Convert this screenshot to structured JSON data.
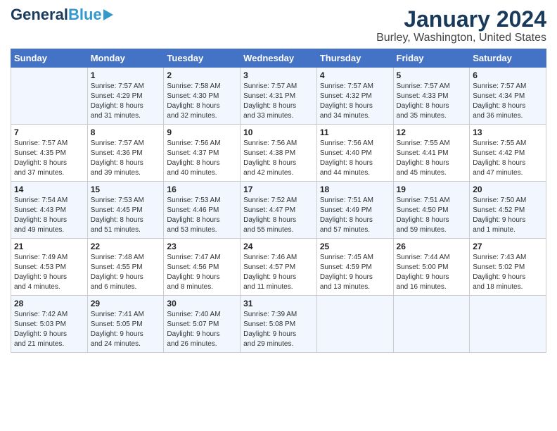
{
  "header": {
    "logo_general": "General",
    "logo_blue": "Blue",
    "title": "January 2024",
    "subtitle": "Burley, Washington, United States"
  },
  "days_of_week": [
    "Sunday",
    "Monday",
    "Tuesday",
    "Wednesday",
    "Thursday",
    "Friday",
    "Saturday"
  ],
  "weeks": [
    [
      {
        "day": "",
        "content": ""
      },
      {
        "day": "1",
        "content": "Sunrise: 7:57 AM\nSunset: 4:29 PM\nDaylight: 8 hours\nand 31 minutes."
      },
      {
        "day": "2",
        "content": "Sunrise: 7:58 AM\nSunset: 4:30 PM\nDaylight: 8 hours\nand 32 minutes."
      },
      {
        "day": "3",
        "content": "Sunrise: 7:57 AM\nSunset: 4:31 PM\nDaylight: 8 hours\nand 33 minutes."
      },
      {
        "day": "4",
        "content": "Sunrise: 7:57 AM\nSunset: 4:32 PM\nDaylight: 8 hours\nand 34 minutes."
      },
      {
        "day": "5",
        "content": "Sunrise: 7:57 AM\nSunset: 4:33 PM\nDaylight: 8 hours\nand 35 minutes."
      },
      {
        "day": "6",
        "content": "Sunrise: 7:57 AM\nSunset: 4:34 PM\nDaylight: 8 hours\nand 36 minutes."
      }
    ],
    [
      {
        "day": "7",
        "content": "Sunrise: 7:57 AM\nSunset: 4:35 PM\nDaylight: 8 hours\nand 37 minutes."
      },
      {
        "day": "8",
        "content": "Sunrise: 7:57 AM\nSunset: 4:36 PM\nDaylight: 8 hours\nand 39 minutes."
      },
      {
        "day": "9",
        "content": "Sunrise: 7:56 AM\nSunset: 4:37 PM\nDaylight: 8 hours\nand 40 minutes."
      },
      {
        "day": "10",
        "content": "Sunrise: 7:56 AM\nSunset: 4:38 PM\nDaylight: 8 hours\nand 42 minutes."
      },
      {
        "day": "11",
        "content": "Sunrise: 7:56 AM\nSunset: 4:40 PM\nDaylight: 8 hours\nand 44 minutes."
      },
      {
        "day": "12",
        "content": "Sunrise: 7:55 AM\nSunset: 4:41 PM\nDaylight: 8 hours\nand 45 minutes."
      },
      {
        "day": "13",
        "content": "Sunrise: 7:55 AM\nSunset: 4:42 PM\nDaylight: 8 hours\nand 47 minutes."
      }
    ],
    [
      {
        "day": "14",
        "content": "Sunrise: 7:54 AM\nSunset: 4:43 PM\nDaylight: 8 hours\nand 49 minutes."
      },
      {
        "day": "15",
        "content": "Sunrise: 7:53 AM\nSunset: 4:45 PM\nDaylight: 8 hours\nand 51 minutes."
      },
      {
        "day": "16",
        "content": "Sunrise: 7:53 AM\nSunset: 4:46 PM\nDaylight: 8 hours\nand 53 minutes."
      },
      {
        "day": "17",
        "content": "Sunrise: 7:52 AM\nSunset: 4:47 PM\nDaylight: 8 hours\nand 55 minutes."
      },
      {
        "day": "18",
        "content": "Sunrise: 7:51 AM\nSunset: 4:49 PM\nDaylight: 8 hours\nand 57 minutes."
      },
      {
        "day": "19",
        "content": "Sunrise: 7:51 AM\nSunset: 4:50 PM\nDaylight: 8 hours\nand 59 minutes."
      },
      {
        "day": "20",
        "content": "Sunrise: 7:50 AM\nSunset: 4:52 PM\nDaylight: 9 hours\nand 1 minute."
      }
    ],
    [
      {
        "day": "21",
        "content": "Sunrise: 7:49 AM\nSunset: 4:53 PM\nDaylight: 9 hours\nand 4 minutes."
      },
      {
        "day": "22",
        "content": "Sunrise: 7:48 AM\nSunset: 4:55 PM\nDaylight: 9 hours\nand 6 minutes."
      },
      {
        "day": "23",
        "content": "Sunrise: 7:47 AM\nSunset: 4:56 PM\nDaylight: 9 hours\nand 8 minutes."
      },
      {
        "day": "24",
        "content": "Sunrise: 7:46 AM\nSunset: 4:57 PM\nDaylight: 9 hours\nand 11 minutes."
      },
      {
        "day": "25",
        "content": "Sunrise: 7:45 AM\nSunset: 4:59 PM\nDaylight: 9 hours\nand 13 minutes."
      },
      {
        "day": "26",
        "content": "Sunrise: 7:44 AM\nSunset: 5:00 PM\nDaylight: 9 hours\nand 16 minutes."
      },
      {
        "day": "27",
        "content": "Sunrise: 7:43 AM\nSunset: 5:02 PM\nDaylight: 9 hours\nand 18 minutes."
      }
    ],
    [
      {
        "day": "28",
        "content": "Sunrise: 7:42 AM\nSunset: 5:03 PM\nDaylight: 9 hours\nand 21 minutes."
      },
      {
        "day": "29",
        "content": "Sunrise: 7:41 AM\nSunset: 5:05 PM\nDaylight: 9 hours\nand 24 minutes."
      },
      {
        "day": "30",
        "content": "Sunrise: 7:40 AM\nSunset: 5:07 PM\nDaylight: 9 hours\nand 26 minutes."
      },
      {
        "day": "31",
        "content": "Sunrise: 7:39 AM\nSunset: 5:08 PM\nDaylight: 9 hours\nand 29 minutes."
      },
      {
        "day": "",
        "content": ""
      },
      {
        "day": "",
        "content": ""
      },
      {
        "day": "",
        "content": ""
      }
    ]
  ]
}
